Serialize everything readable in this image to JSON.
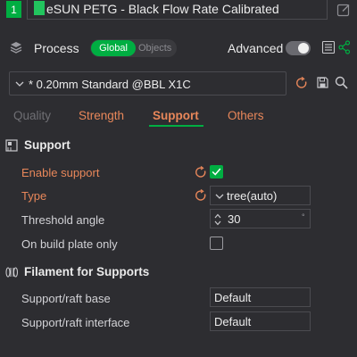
{
  "filament": {
    "slot_number": "1",
    "color": "#22c55e",
    "name": "eSUN PETG - Black Flow Rate Calibrated"
  },
  "process": {
    "title": "Process",
    "scope_global": "Global",
    "scope_objects": "Objects",
    "advanced_label": "Advanced",
    "advanced_on": false,
    "preset_name": "* 0.20mm Standard @BBL X1C"
  },
  "tabs": [
    {
      "label": "Quality",
      "state": "disabled"
    },
    {
      "label": "Strength",
      "state": "modified"
    },
    {
      "label": "Support",
      "state": "selected"
    },
    {
      "label": "Others",
      "state": "modified"
    }
  ],
  "support_section": {
    "title": "Support",
    "enable_support": {
      "label": "Enable support",
      "checked": true
    },
    "type": {
      "label": "Type",
      "value": "tree(auto)"
    },
    "threshold_angle": {
      "label": "Threshold angle",
      "value": "30",
      "unit": "°"
    },
    "on_build_plate_only": {
      "label": "On build plate only",
      "checked": false
    }
  },
  "filament_section": {
    "title": "Filament for Supports",
    "raft_base": {
      "label": "Support/raft base",
      "value": "Default"
    },
    "raft_interface": {
      "label": "Support/raft interface",
      "value": "Default"
    }
  },
  "colors": {
    "accent_green": "#00ae42",
    "modified_orange": "#e8875a",
    "background": "#2d2d31"
  }
}
